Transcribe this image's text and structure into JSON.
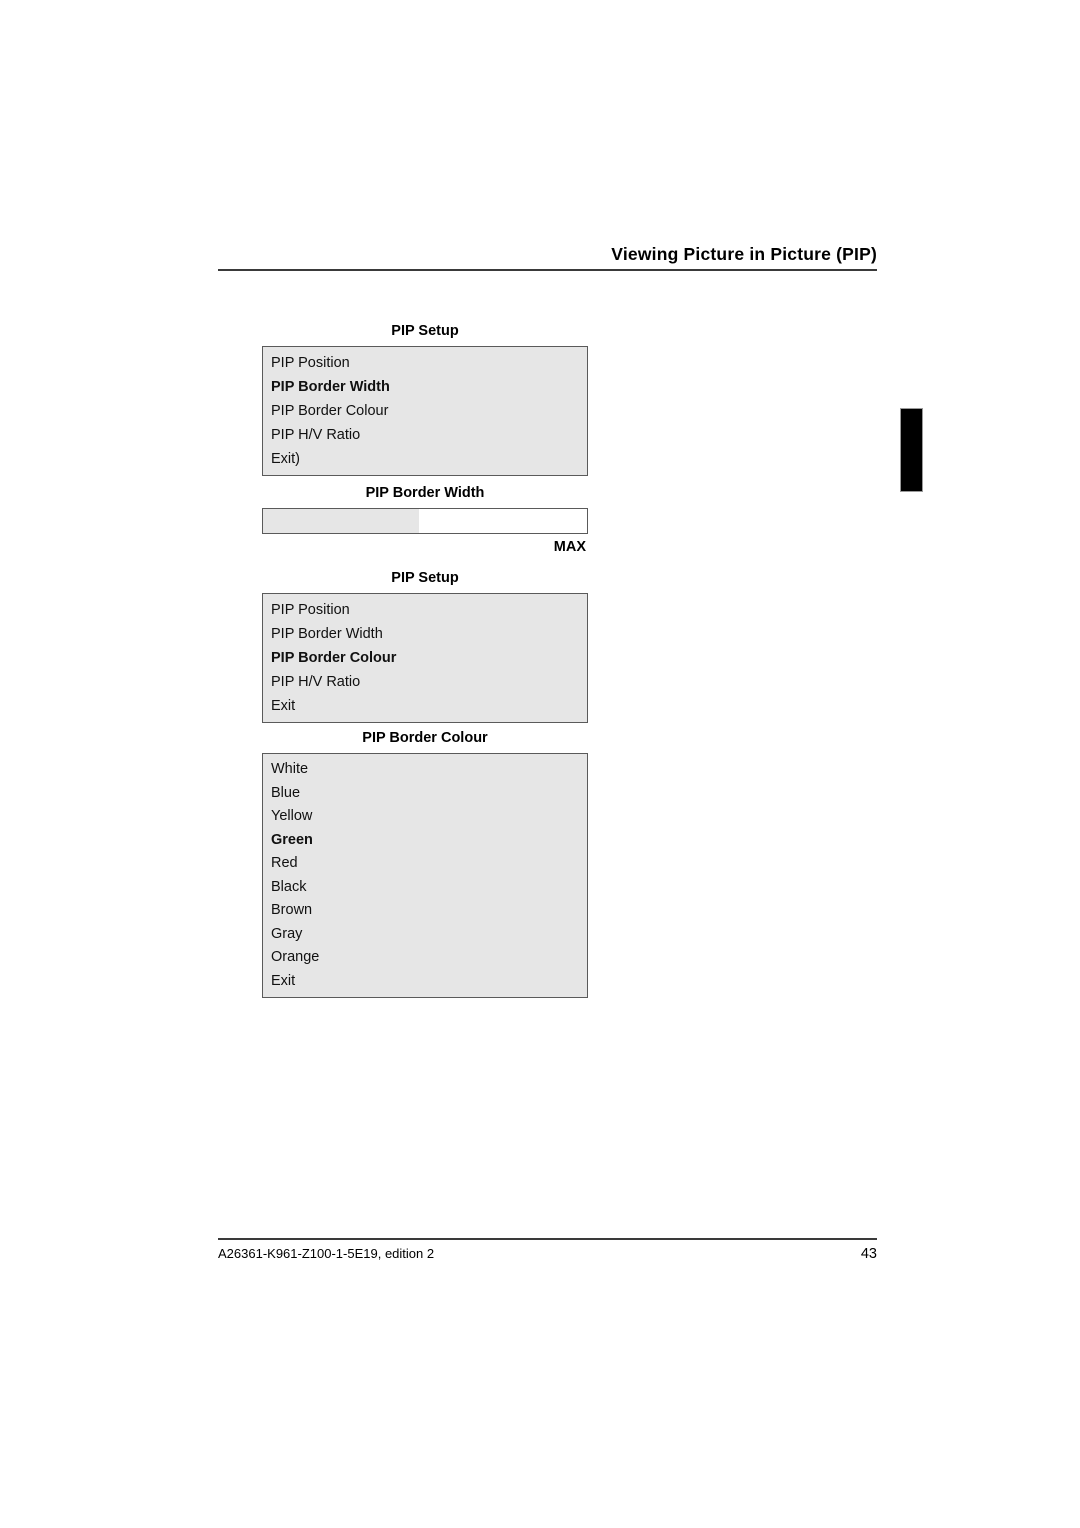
{
  "header": {
    "title": "Viewing Picture in Picture (PIP)"
  },
  "figures": {
    "pip_setup_width": {
      "caption": "PIP Setup",
      "items": [
        {
          "label": "PIP Position",
          "selected": false
        },
        {
          "label": "PIP Border Width",
          "selected": true
        },
        {
          "label": "PIP Border Colour",
          "selected": false
        },
        {
          "label": "PIP H/V Ratio",
          "selected": false
        },
        {
          "label": "Exit)",
          "selected": false
        }
      ]
    },
    "pip_border_width_slider": {
      "caption": "PIP Border Width",
      "max_label": "MAX",
      "fill_percent": 48
    },
    "pip_setup_colour": {
      "caption": "PIP Setup",
      "items": [
        {
          "label": "PIP Position",
          "selected": false
        },
        {
          "label": "PIP Border Width",
          "selected": false
        },
        {
          "label": "PIP Border Colour",
          "selected": true
        },
        {
          "label": "PIP H/V Ratio",
          "selected": false
        },
        {
          "label": "Exit",
          "selected": false
        }
      ]
    },
    "pip_border_colour_list": {
      "caption": "PIP Border Colour",
      "items": [
        {
          "label": "White",
          "selected": false
        },
        {
          "label": "Blue",
          "selected": false
        },
        {
          "label": "Yellow",
          "selected": false
        },
        {
          "label": "Green",
          "selected": true
        },
        {
          "label": "Red",
          "selected": false
        },
        {
          "label": "Black",
          "selected": false
        },
        {
          "label": "Brown",
          "selected": false
        },
        {
          "label": "Gray",
          "selected": false
        },
        {
          "label": "Orange",
          "selected": false
        },
        {
          "label": "Exit",
          "selected": false
        }
      ]
    }
  },
  "footer": {
    "document_id": "A26361-K961-Z100-1-5E19, edition 2",
    "page_number": "43"
  }
}
